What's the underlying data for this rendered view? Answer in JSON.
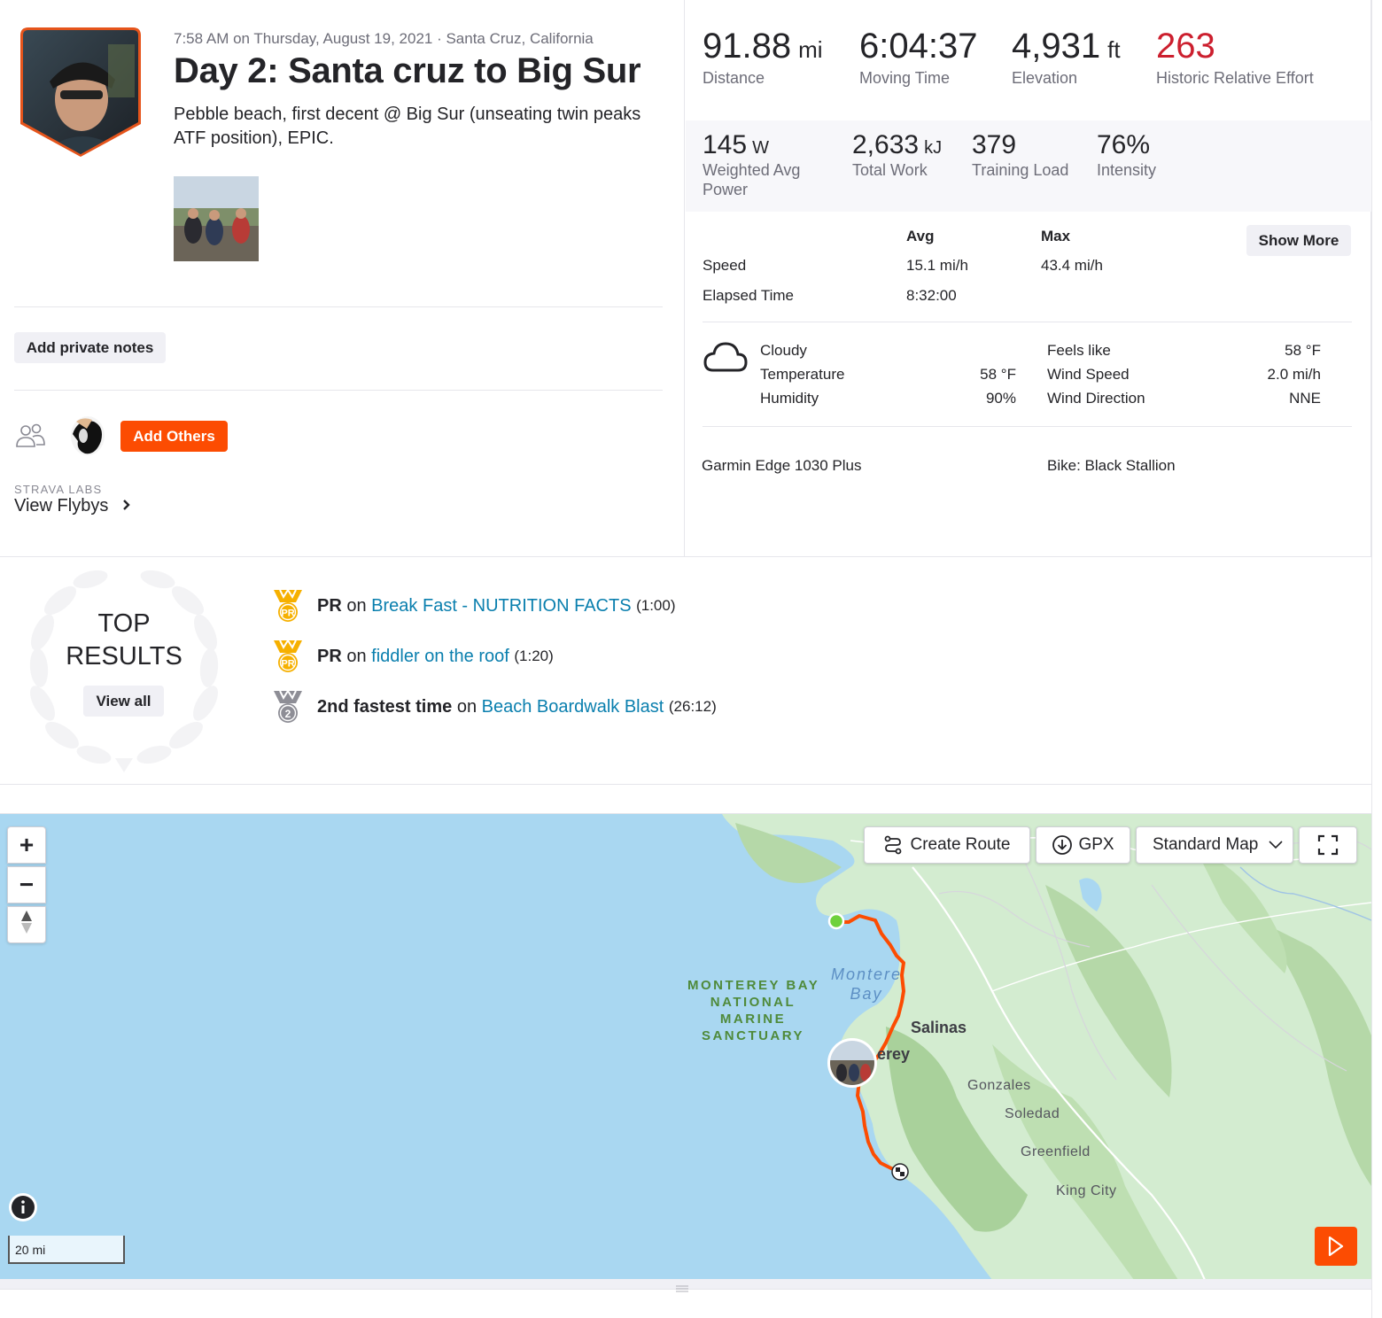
{
  "activity": {
    "time_location": "7:58 AM on Thursday, August 19, 2021 · Santa Cruz, California",
    "title": "Day 2: Santa cruz to Big Sur",
    "description": "Pebble beach, first decent @ Big Sur (unseating twin peaks ATF position), EPIC."
  },
  "actions": {
    "add_private_notes": "Add private notes",
    "add_others": "Add Others"
  },
  "labs": {
    "label": "STRAVA LABS",
    "link": "View Flybys"
  },
  "primary_stats": [
    {
      "value": "91.88",
      "unit": "mi",
      "label": "Distance"
    },
    {
      "value": "6:04:37",
      "unit": "",
      "label": "Moving Time"
    },
    {
      "value": "4,931",
      "unit": "ft",
      "label": "Elevation"
    },
    {
      "value": "263",
      "unit": "",
      "label": "Historic Relative Effort"
    }
  ],
  "secondary_stats": [
    {
      "value": "145",
      "unit": "W",
      "label": "Weighted Avg Power"
    },
    {
      "value": "2,633",
      "unit": "kJ",
      "label": "Total Work"
    },
    {
      "value": "379",
      "unit": "",
      "label": "Training Load"
    },
    {
      "value": "76%",
      "unit": "",
      "label": "Intensity"
    }
  ],
  "detail_table": {
    "col_avg": "Avg",
    "col_max": "Max",
    "show_more": "Show More",
    "rows": [
      {
        "label": "Speed",
        "avg": "15.1 mi/h",
        "max": "43.4 mi/h"
      },
      {
        "label": "Elapsed Time",
        "avg": "8:32:00",
        "max": ""
      }
    ]
  },
  "weather": {
    "icon": "cloud-icon",
    "condition": "Cloudy",
    "temperature_label": "Temperature",
    "temperature": "58 °F",
    "humidity_label": "Humidity",
    "humidity": "90%",
    "feels_like_label": "Feels like",
    "feels_like": "58 °F",
    "wind_speed_label": "Wind Speed",
    "wind_speed": "2.0 mi/h",
    "wind_direction_label": "Wind Direction",
    "wind_direction": "NNE"
  },
  "gear": {
    "device": "Garmin Edge 1030 Plus",
    "bike": "Bike: Black Stallion"
  },
  "top_results": {
    "title_line1": "TOP",
    "title_line2": "RESULTS",
    "view_all": "View all",
    "items": [
      {
        "medal": "pr-medal-icon",
        "badge": "PR",
        "kind": "PR",
        "on": "on",
        "segment": "Break Fast - NUTRITION FACTS",
        "time": "(1:00)"
      },
      {
        "medal": "pr-medal-icon",
        "badge": "PR",
        "kind": "PR",
        "on": "on",
        "segment": "fiddler on the roof",
        "time": "(1:20)"
      },
      {
        "medal": "second-place-medal-icon",
        "badge": "2",
        "kind": "2nd fastest time",
        "on": "on",
        "segment": "Beach Boardwalk Blast",
        "time": "(26:12)"
      }
    ]
  },
  "map": {
    "create_route": "Create Route",
    "gpx": "GPX",
    "map_type": "Standard Map",
    "scale": "20 mi",
    "zoom_in": "+",
    "zoom_out": "−",
    "labels": {
      "sanctuary": [
        "MONTEREY BAY",
        "NATIONAL",
        "MARINE",
        "SANCTUARY"
      ],
      "bay": [
        "Montere",
        "Bay"
      ],
      "salinas": "Salinas",
      "monterey": "erey",
      "gonzales": "Gonzales",
      "soledad": "Soledad",
      "greenfield": "Greenfield",
      "king_city": "King City"
    },
    "colors": {
      "route": "#fc4c02",
      "water": "#a9d7f1",
      "land": "#d3ecd0",
      "start": "#6fd13d"
    }
  },
  "colors": {
    "brand": "#fc4c02",
    "relative_effort": "#cc1f2e",
    "link": "#0a7fae",
    "medal_gold": "#f6b000"
  }
}
